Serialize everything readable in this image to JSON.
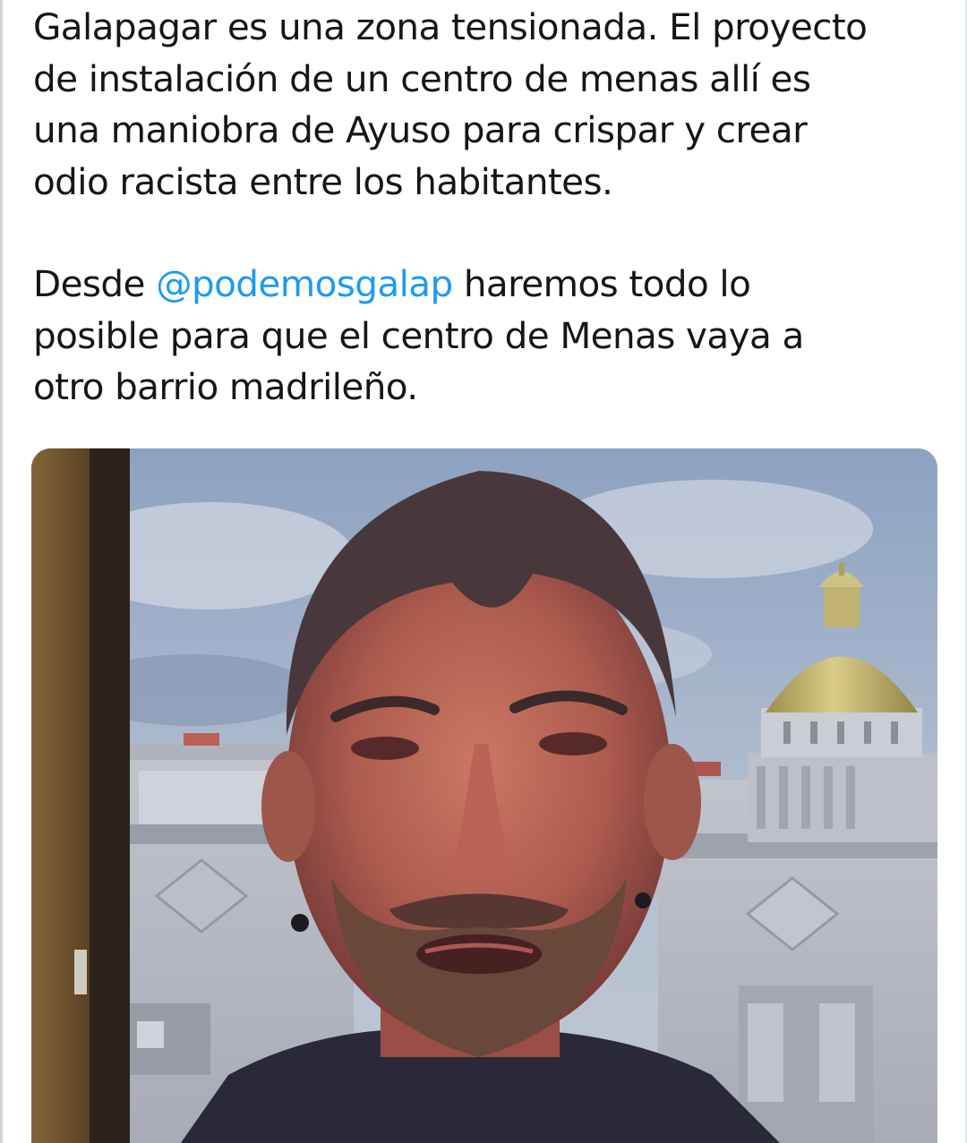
{
  "tweet": {
    "paragraph_1": "Galapagar es una zona tensionada. El proyecto\nde instalación de un centro de menas allí es\nuna maniobra de Ayuso para crispar y crear\nodio racista entre los habitantes.",
    "paragraph_2_prefix": "Desde ",
    "mention": "@podemosgalap",
    "paragraph_2_suffix": " haremos todo lo\nposible para que el centro de Menas vaya a\notro barrio madrileño."
  },
  "media": {
    "type": "video-thumbnail"
  },
  "colors": {
    "text": "#14171a",
    "mention": "#1d9bf0",
    "background": "#ffffff"
  }
}
